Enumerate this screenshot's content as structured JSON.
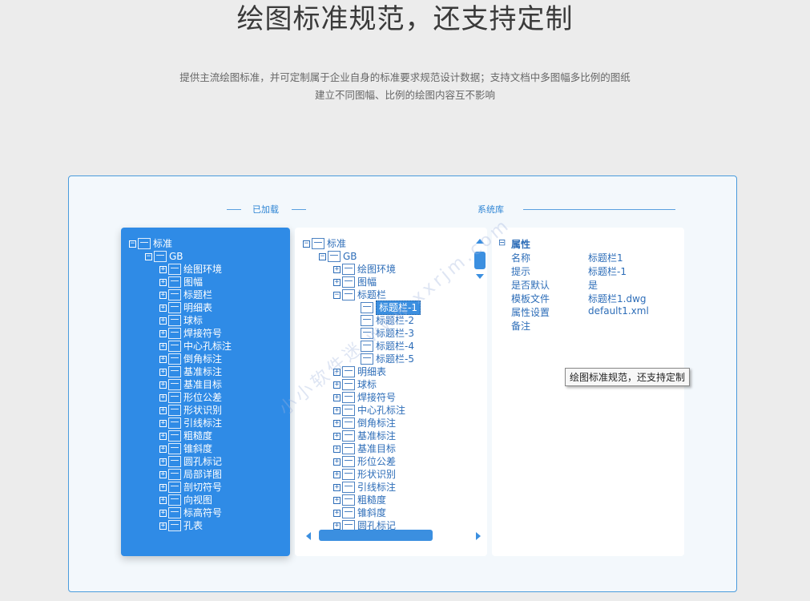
{
  "header": {
    "title": "绘图标准规范，还支持定制",
    "subtitle_line1": "提供主流绘图标准，并可定制属于企业自身的标准要求规范设计数据；支持文档中多图幅多比例的图纸",
    "subtitle_line2": "建立不同图幅、比例的绘图内容互不影响"
  },
  "sections": {
    "loaded": "已加载",
    "library": "系统库"
  },
  "loaded_tree": {
    "root": "标准",
    "gb": "GB",
    "items": [
      "绘图环境",
      "图幅",
      "标题栏",
      "明细表",
      "球标",
      "焊接符号",
      "中心孔标注",
      "倒角标注",
      "基准标注",
      "基准目标",
      "形位公差",
      "形状识别",
      "引线标注",
      "粗糙度",
      "锥斜度",
      "圆孔标记",
      "局部详图",
      "剖切符号",
      "向视图",
      "标高符号",
      "孔表"
    ]
  },
  "library_tree": {
    "root": "标准",
    "gb": "GB",
    "items_before": [
      "绘图环境",
      "图幅"
    ],
    "expanded": "标题栏",
    "children": [
      "标题栏-1",
      "标题栏-2",
      "标题栏-3",
      "标题栏-4",
      "标题栏-5"
    ],
    "items_after": [
      "明细表",
      "球标",
      "焊接符号",
      "中心孔标注",
      "倒角标注",
      "基准标注",
      "基准目标",
      "形位公差",
      "形状识别",
      "引线标注",
      "粗糙度",
      "锥斜度",
      "圆孔标记"
    ]
  },
  "properties": {
    "heading": "属性",
    "rows": [
      {
        "key": "名称",
        "value": "标题栏1"
      },
      {
        "key": "提示",
        "value": "标题栏-1"
      },
      {
        "key": "是否默认",
        "value": "是"
      },
      {
        "key": "模板文件",
        "value": "标题栏1.dwg"
      },
      {
        "key": "属性设置",
        "value": "default1.xml"
      },
      {
        "key": "备注",
        "value": ""
      }
    ]
  },
  "tooltip": "绘图标准规范，还支持定制",
  "watermark": "小小软件迷 www.xxrjm.com"
}
